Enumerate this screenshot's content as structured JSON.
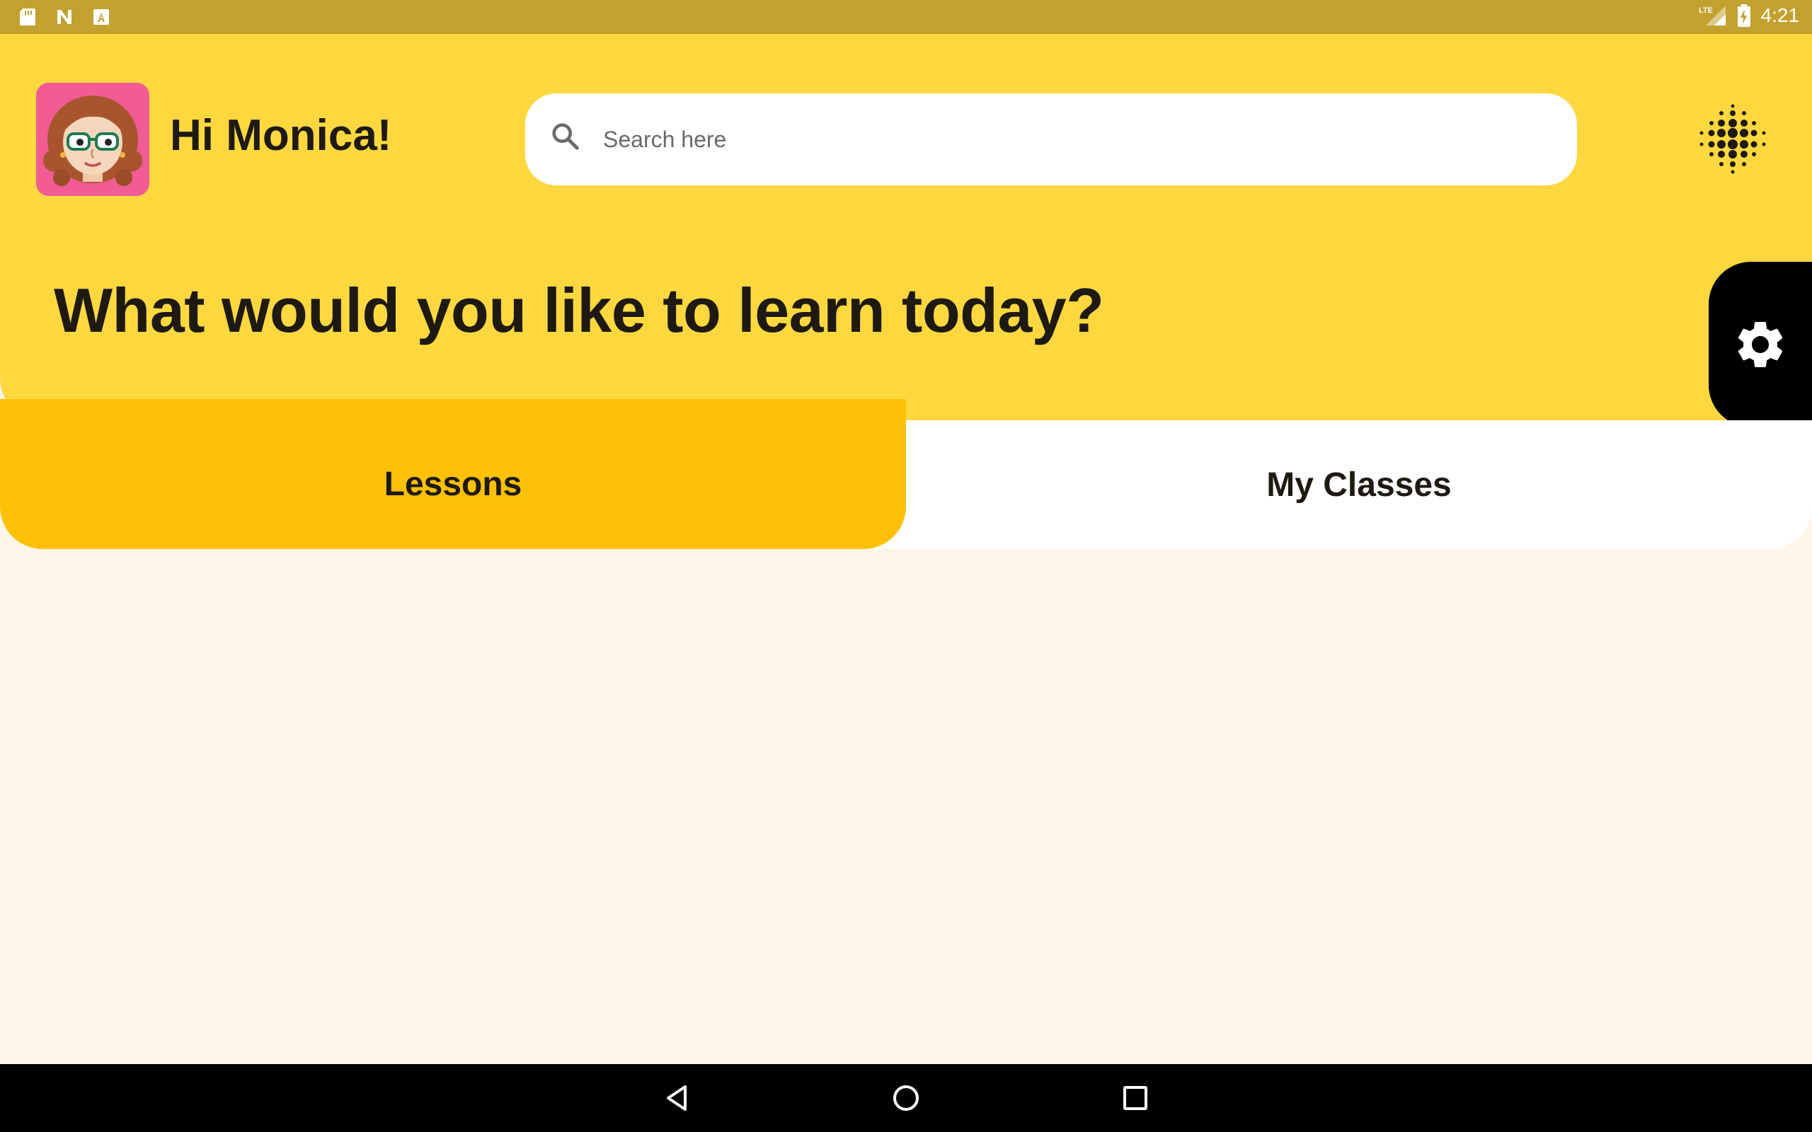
{
  "status_bar": {
    "time": "4:21",
    "network": "LTE",
    "left_icons": [
      "sd-card-icon",
      "n-notification-icon",
      "a-notification-icon"
    ],
    "right_icons": [
      "lte-signal-icon",
      "battery-charging-icon"
    ]
  },
  "header": {
    "greeting": "Hi Monica!",
    "avatar_icon": "avatar-girl-glasses",
    "search": {
      "placeholder": "Search here",
      "value": ""
    },
    "headline": "What would you like to learn today?",
    "menu_icon": "dots-grid-icon",
    "settings_icon": "gear-icon"
  },
  "tabs": [
    {
      "label": "Lessons",
      "selected": true
    },
    {
      "label": "My Classes",
      "selected": false
    }
  ],
  "nav_bar": {
    "icons": [
      "back-icon",
      "home-icon",
      "recents-icon"
    ]
  },
  "colors": {
    "status_bar": "#C2A12F",
    "header": "#FFD840",
    "active_tab": "#FFC107",
    "background": "#FFF6EA",
    "avatar_bg": "#F05C93"
  }
}
